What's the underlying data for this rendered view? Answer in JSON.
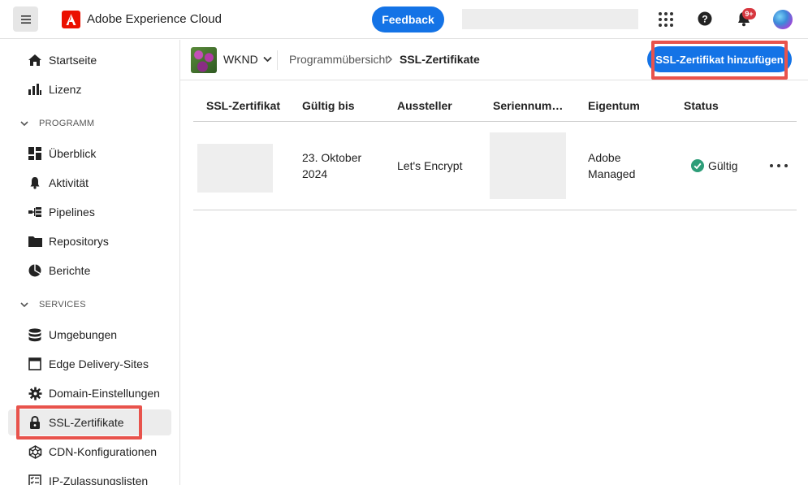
{
  "header": {
    "brand": "Adobe Experience Cloud",
    "feedback_label": "Feedback",
    "search_placeholder": "",
    "notifications_badge": "9+"
  },
  "sidebar": {
    "items_top": [
      {
        "label": "Startseite",
        "icon": "home-icon"
      },
      {
        "label": "Lizenz",
        "icon": "license-icon"
      }
    ],
    "section_program": "PROGRAMM",
    "items_program": [
      {
        "label": "Überblick",
        "icon": "overview-icon"
      },
      {
        "label": "Aktivität",
        "icon": "bell-icon"
      },
      {
        "label": "Pipelines",
        "icon": "pipelines-icon"
      },
      {
        "label": "Repositorys",
        "icon": "folder-icon"
      },
      {
        "label": "Berichte",
        "icon": "reports-icon"
      }
    ],
    "section_services": "SERVICES",
    "items_services": [
      {
        "label": "Umgebungen",
        "icon": "database-icon"
      },
      {
        "label": "Edge Delivery-Sites",
        "icon": "window-icon"
      },
      {
        "label": "Domain-Einstellungen",
        "icon": "gear-icon"
      },
      {
        "label": "SSL-Zertifikate",
        "icon": "lock-icon",
        "active": true
      },
      {
        "label": "CDN-Konfigurationen",
        "icon": "cdn-icon"
      },
      {
        "label": "IP-Zulassungslisten",
        "icon": "list-icon"
      }
    ]
  },
  "context": {
    "program_name": "WKND",
    "breadcrumb_parent": "Programmübersicht",
    "breadcrumb_current": "SSL-Zertifikate",
    "add_button_label": "SSL-Zertifikat hinzufügen"
  },
  "table": {
    "columns": [
      "SSL-Zertifikat",
      "Gültig bis",
      "Aussteller",
      "Seriennum…",
      "Eigentum",
      "Status"
    ],
    "rows": [
      {
        "valid_until_line1": "23. Oktober",
        "valid_until_line2": "2024",
        "issuer": "Let's Encrypt",
        "ownership_line1": "Adobe",
        "ownership_line2": "Managed",
        "status": "Gültig"
      }
    ]
  },
  "colors": {
    "accent": "#1473e6",
    "highlight": "#e8534c",
    "status_ok": "#2d9d78"
  }
}
